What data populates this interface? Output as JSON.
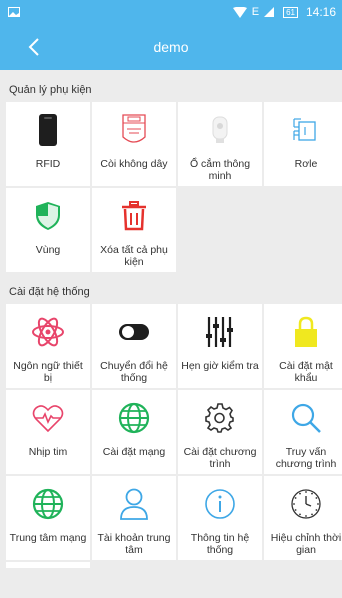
{
  "status": {
    "time": "14:16",
    "battery": "61"
  },
  "header": {
    "title": "demo"
  },
  "accessories": {
    "title": "Quản lý phụ kiện",
    "items": [
      {
        "label": "RFID",
        "icon": "rfid-card-icon"
      },
      {
        "label": "Còi không dây",
        "icon": "siren-icon"
      },
      {
        "label": "Ổ cắm thông minh",
        "icon": "smart-plug-icon"
      },
      {
        "label": "Rơle",
        "icon": "relay-icon"
      },
      {
        "label": "Vùng",
        "icon": "shield-icon"
      },
      {
        "label": "Xóa tất cả phụ kiện",
        "icon": "trash-icon"
      }
    ]
  },
  "system": {
    "title": "Cài đặt hệ thống",
    "items": [
      {
        "label": "Ngôn ngữ thiết bị",
        "icon": "atom-icon"
      },
      {
        "label": "Chuyển đổi hệ thống",
        "icon": "toggle-icon"
      },
      {
        "label": "Hẹn giờ kiểm tra",
        "icon": "equalizer-icon"
      },
      {
        "label": "Cài đặt mật khẩu",
        "icon": "lock-icon"
      },
      {
        "label": "Nhịp tim",
        "icon": "heartbeat-icon"
      },
      {
        "label": "Cài đặt mạng",
        "icon": "globe-icon"
      },
      {
        "label": "Cài đặt chương trình",
        "icon": "gear-icon"
      },
      {
        "label": "Truy vấn chương trình",
        "icon": "search-icon"
      },
      {
        "label": "Trung tâm mạng",
        "icon": "globe-icon"
      },
      {
        "label": "Tài khoản trung tâm",
        "icon": "user-icon"
      },
      {
        "label": "Thông tin hệ thống",
        "icon": "info-icon"
      },
      {
        "label": "Hiệu chỉnh thời gian",
        "icon": "clock-icon"
      }
    ]
  },
  "colors": {
    "header": "#4fb6ec",
    "green": "#20b35a",
    "red": "#e5322d",
    "blue": "#3ea7e6",
    "pink": "#e8456b",
    "yellow": "#f0e81f"
  }
}
